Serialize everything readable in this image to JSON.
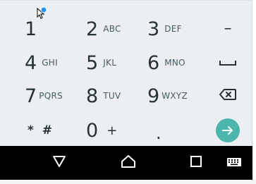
{
  "keypad": {
    "k1": {
      "digit": "1",
      "letters": ""
    },
    "k2": {
      "digit": "2",
      "letters": "ABC"
    },
    "k3": {
      "digit": "3",
      "letters": "DEF"
    },
    "k4": {
      "digit": "4",
      "letters": "GHI"
    },
    "k5": {
      "digit": "5",
      "letters": "JKL"
    },
    "k6": {
      "digit": "6",
      "letters": "MNO"
    },
    "k7": {
      "digit": "7",
      "letters": "PQRS"
    },
    "k8": {
      "digit": "8",
      "letters": "TUV"
    },
    "k9": {
      "digit": "9",
      "letters": "WXYZ"
    },
    "k0": {
      "digit": "0",
      "symbol": "+"
    },
    "star_hash": "* #",
    "period": ".",
    "dash": "–"
  },
  "icons": {
    "space": "space-bar-icon",
    "backspace": "backspace-icon",
    "enter": "arrow-right-icon",
    "back": "back-triangle-icon",
    "home": "home-icon",
    "recents": "square-recents-icon",
    "keyboard": "keyboard-icon"
  },
  "colors": {
    "keyboard_bg": "#eceff1",
    "key_text": "#263238",
    "accent": "#4db6ac",
    "navbar": "#000000"
  }
}
